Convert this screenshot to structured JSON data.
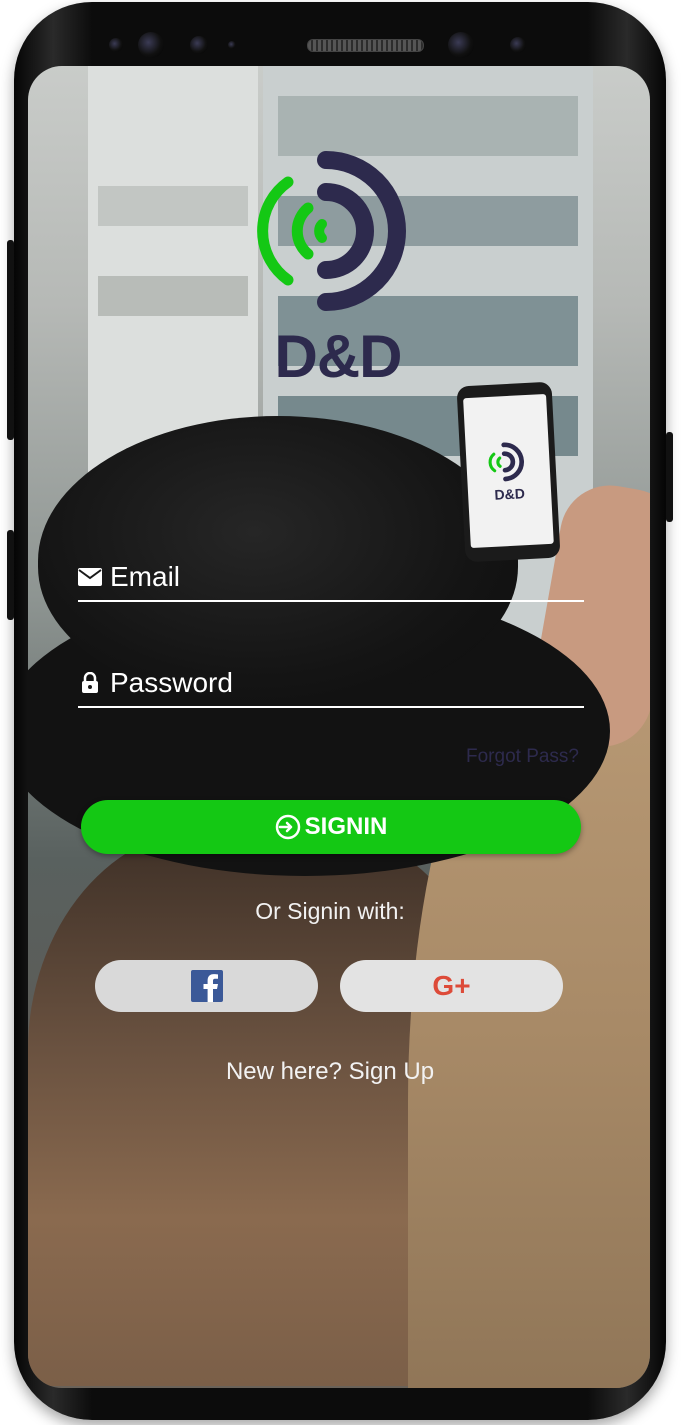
{
  "brand": {
    "name": "D&D",
    "held_phone_label": "D&D"
  },
  "login": {
    "email_placeholder": "Email",
    "password_placeholder": "Password",
    "forgot_label": "Forgot Pass?",
    "signin_label": "SIGNIN",
    "or_label": "Or Signin with:",
    "signup_label": "New here? Sign Up"
  },
  "social": {
    "facebook_icon": "facebook-icon",
    "google_icon": "google-plus-icon",
    "google_label": "G+"
  },
  "colors": {
    "primary_green": "#14c814",
    "brand_navy": "#2d2a4d",
    "social_button_bg": "#d9d9d9",
    "facebook_blue": "#3b5998",
    "google_red": "#dd4b39"
  }
}
